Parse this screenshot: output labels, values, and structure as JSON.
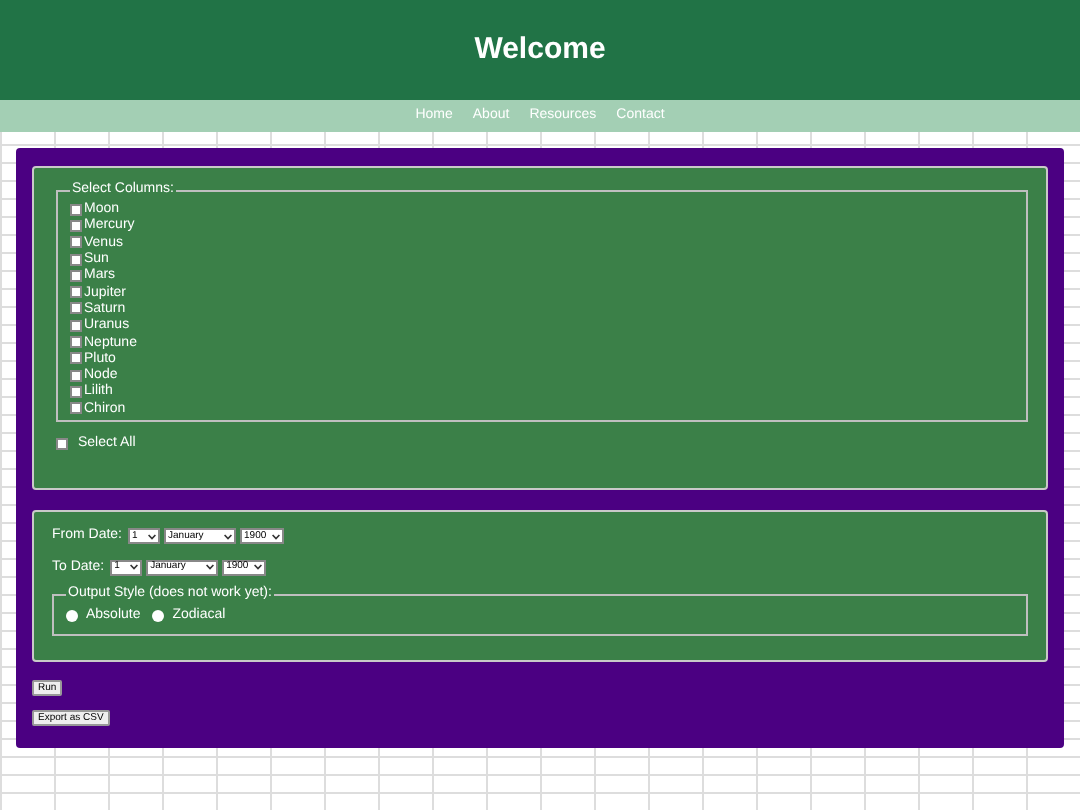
{
  "header": {
    "title": "Welcome"
  },
  "nav": [
    "Home",
    "About",
    "Resources",
    "Contact"
  ],
  "columns": {
    "legend": "Select Columns:",
    "items": [
      {
        "label": "Moon",
        "checked": false
      },
      {
        "label": "Mercury",
        "checked": false
      },
      {
        "label": "Venus",
        "checked": false
      },
      {
        "label": "Sun",
        "checked": false
      },
      {
        "label": "Mars",
        "checked": false
      },
      {
        "label": "Jupiter",
        "checked": false
      },
      {
        "label": "Saturn",
        "checked": false
      },
      {
        "label": "Uranus",
        "checked": false
      },
      {
        "label": "Neptune",
        "checked": false
      },
      {
        "label": "Pluto",
        "checked": false
      },
      {
        "label": "Node",
        "checked": false
      },
      {
        "label": "Lilith",
        "checked": false
      },
      {
        "label": "Chiron",
        "checked": false
      }
    ],
    "select_all": {
      "label": "Select All",
      "checked": false
    }
  },
  "dates": [
    {
      "label": "From Date:",
      "day": "1",
      "month": "January",
      "year": "1900"
    },
    {
      "label": "To Date:",
      "day": "1",
      "month": "January",
      "year": "1900"
    }
  ],
  "output_style": {
    "legend": "Output Style (does not work yet):",
    "options": [
      {
        "label": "Absolute",
        "selected": false
      },
      {
        "label": "Zodiacal",
        "selected": false
      }
    ]
  },
  "buttons": [
    "Run",
    "Export as CSV"
  ]
}
